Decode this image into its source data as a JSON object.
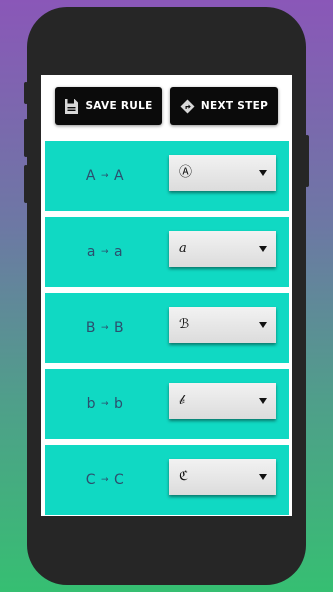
{
  "toolbar": {
    "save_label": "SAVE RULE",
    "next_label": "NEXT STEP"
  },
  "rules": [
    {
      "from": "A",
      "to": "A",
      "value": "Ⓐ"
    },
    {
      "from": "a",
      "to": "a",
      "value": "𝑎"
    },
    {
      "from": "B",
      "to": "B",
      "value": "ℬ"
    },
    {
      "from": "b",
      "to": "b",
      "value": "𝒷"
    },
    {
      "from": "C",
      "to": "C",
      "value": "ℭ"
    }
  ],
  "arrow": "→",
  "colors": {
    "row_background": "#10d9c3",
    "label_text": "#2c4f6e",
    "button_background": "#0b0b0b"
  }
}
